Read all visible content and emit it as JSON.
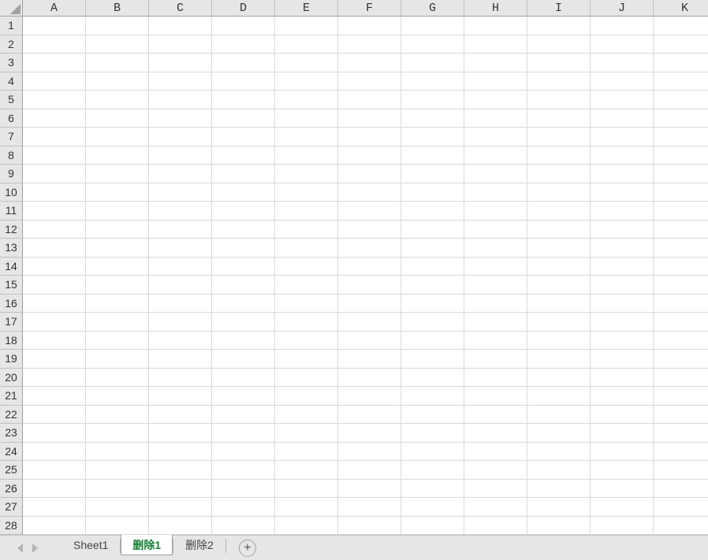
{
  "grid": {
    "columns": [
      "A",
      "B",
      "C",
      "D",
      "E",
      "F",
      "G",
      "H",
      "I",
      "J",
      "K"
    ],
    "rows": [
      "1",
      "2",
      "3",
      "4",
      "5",
      "6",
      "7",
      "8",
      "9",
      "10",
      "11",
      "12",
      "13",
      "14",
      "15",
      "16",
      "17",
      "18",
      "19",
      "20",
      "21",
      "22",
      "23",
      "24",
      "25",
      "26",
      "27",
      "28"
    ]
  },
  "tabs": {
    "items": [
      {
        "label": "Sheet1",
        "active": false
      },
      {
        "label": "删除1",
        "active": true
      },
      {
        "label": "删除2",
        "active": false
      }
    ],
    "add_label": "+"
  }
}
